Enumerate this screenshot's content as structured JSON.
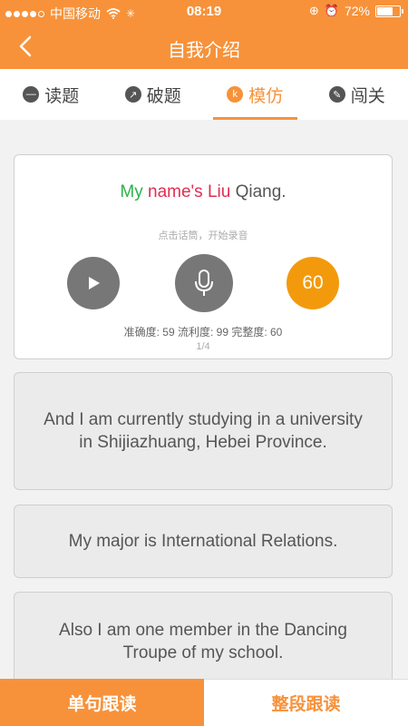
{
  "status": {
    "carrier": "中国移动",
    "time": "08:19",
    "battery": "72%",
    "battery_level": 0.72
  },
  "nav": {
    "title": "自我介绍"
  },
  "tabs": [
    {
      "label": "读题",
      "icon": "minus-icon"
    },
    {
      "label": "破题",
      "icon": "arc-icon"
    },
    {
      "label": "模仿",
      "icon": "ks-icon",
      "active": true
    },
    {
      "label": "闯关",
      "icon": "pencil-icon"
    }
  ],
  "active_card": {
    "words": [
      "My",
      "name's",
      "Liu",
      "Qiang."
    ],
    "hint": "点击话筒，开始录音",
    "score": "60",
    "metrics": "准确度: 59 流利度: 99 完整度: 60",
    "page": "1/4"
  },
  "sentences": [
    "And I am currently studying in a university in Shijiazhuang, Hebei Province.",
    "My major is International Relations.",
    "Also I am one member in the Dancing Troupe of my school."
  ],
  "bottom": {
    "single": "单句跟读",
    "whole": "整段跟读"
  },
  "colors": {
    "accent": "#f7923a",
    "score": "#f39a0c",
    "green": "#2bb24c",
    "red": "#e02e52"
  }
}
